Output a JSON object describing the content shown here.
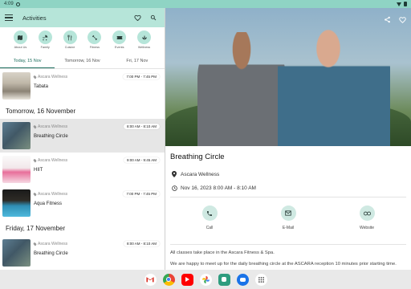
{
  "status_bar": {
    "time": "4:09"
  },
  "app": {
    "title": "Activities"
  },
  "categories": [
    {
      "label": "About Us",
      "icon": "map-icon"
    },
    {
      "label": "Family",
      "icon": "stroller-icon"
    },
    {
      "label": "Cuisine",
      "icon": "cutlery-icon"
    },
    {
      "label": "Fitness",
      "icon": "dumbbell-icon"
    },
    {
      "label": "Events",
      "icon": "ticket-icon"
    },
    {
      "label": "Wellness",
      "icon": "lotus-icon"
    }
  ],
  "days": [
    "Today, 15 Nov",
    "Tomorrow, 16 Nov",
    "Fri, 17 Nov"
  ],
  "active_day_index": 0,
  "list": {
    "today": [
      {
        "location": "Ascara Wellness",
        "title": "Tabata",
        "time": "7:00 PM - 7:45 PM"
      }
    ],
    "tomorrow_header": "Tomorrow, 16 November",
    "tomorrow": [
      {
        "location": "Ascara Wellness",
        "title": "Breathing Circle",
        "time": "8:00 AM - 8:10 AM"
      },
      {
        "location": "Ascara Wellness",
        "title": "HIIT",
        "time": "9:00 AM - 9:45 AM"
      },
      {
        "location": "Ascara Wellness",
        "title": "Aqua Fitness",
        "time": "7:00 PM - 7:45 PM"
      }
    ],
    "friday_header": "Friday, 17 November",
    "friday": [
      {
        "location": "Ascara Wellness",
        "title": "Breathing Circle",
        "time": "8:00 AM - 8:10 AM"
      }
    ]
  },
  "detail": {
    "title": "Breathing Circle",
    "location": "Ascara Wellness",
    "datetime": "Nov 16, 2023 8:00 AM - 8:10 AM",
    "actions": [
      {
        "label": "Call",
        "icon": "phone-icon"
      },
      {
        "label": "E-Mail",
        "icon": "mail-icon"
      },
      {
        "label": "Website",
        "icon": "link-icon"
      }
    ],
    "description": [
      "All classes take place in the Ascara Fitness & Spa.",
      "We are happy to meet up for the daily breathing circle at the ASCARA reception 10 minutes prior starting time."
    ]
  },
  "colors": {
    "accent": "#b6e5d9",
    "statusbar": "#8fd4c4",
    "primary": "#1d6e5e"
  }
}
